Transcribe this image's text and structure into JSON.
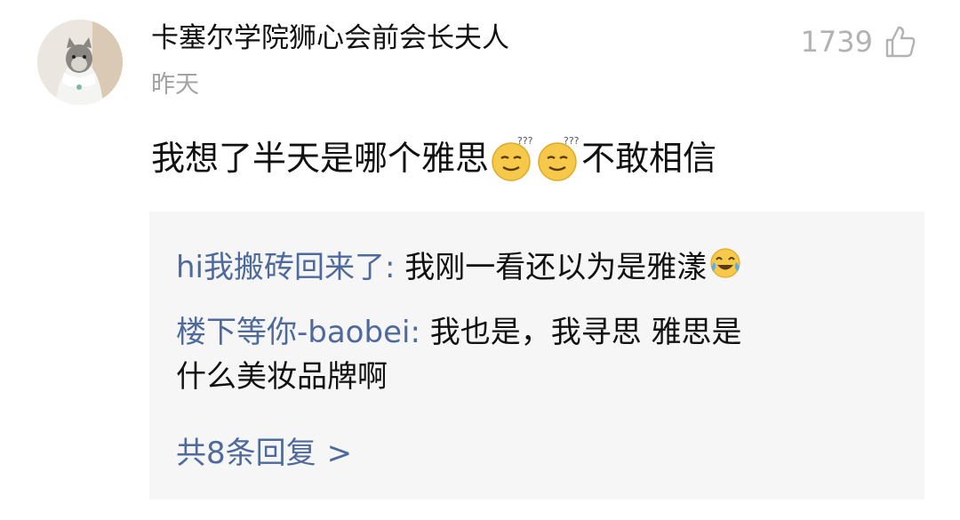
{
  "comment": {
    "username": "卡塞尔学院狮心会前会长夫人",
    "time": "昨天",
    "likes": "1739",
    "content_before": "我想了半天是哪个雅思",
    "content_emoji": "dizzy-face-emoji",
    "content_after": "不敢相信"
  },
  "replies": [
    {
      "user": "hi我搬砖回来了",
      "sep": ": ",
      "text": "我刚一看还以为是雅漾",
      "emoji": "tears-of-joy-emoji"
    },
    {
      "user": "楼下等你-baobei",
      "sep": ": ",
      "text_line1": "我也是，我寻思 雅思是",
      "text_line2": "什么美妆品牌啊"
    }
  ],
  "more": {
    "label": "共8条回复",
    "arrow": ">"
  },
  "icons": {
    "like": "thumbs-up-icon",
    "avatar": "cat-avatar"
  }
}
